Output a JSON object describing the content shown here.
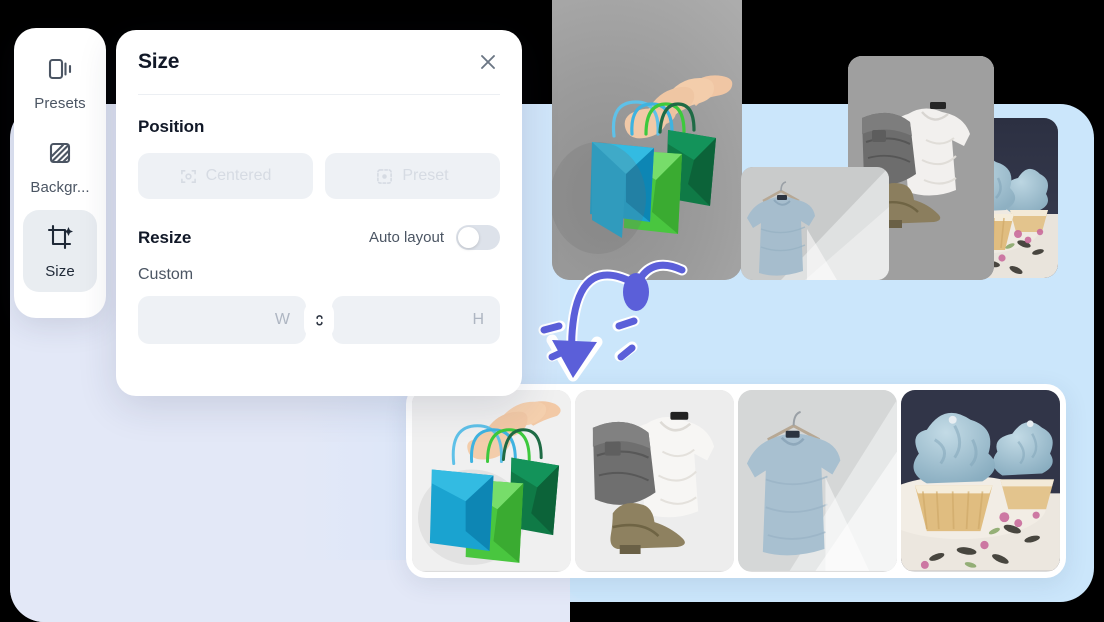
{
  "app": {
    "background_lavender": "#e3e8f7",
    "background_blue": "#cbe6fb"
  },
  "sidebar": {
    "items": [
      {
        "label": "Presets",
        "icon": "carousel-icon",
        "active": false
      },
      {
        "label": "Backgr...",
        "icon": "background-pattern-icon",
        "active": false
      },
      {
        "label": "Size",
        "icon": "crop-sparkle-icon",
        "active": true
      }
    ]
  },
  "panel": {
    "title": "Size",
    "close_icon": "close-icon",
    "position": {
      "heading": "Position",
      "buttons": [
        {
          "label": "Centered",
          "icon": "center-target-icon"
        },
        {
          "label": "Preset",
          "icon": "preset-target-icon"
        }
      ]
    },
    "resize": {
      "heading": "Resize",
      "auto_layout_label": "Auto layout",
      "auto_layout_on": false,
      "custom_label": "Custom",
      "width_value": "",
      "width_unit": "W",
      "height_value": "",
      "height_unit": "H",
      "link_icon": "unlink-aspect-ratio-icon"
    }
  },
  "canvas": {
    "cards": [
      {
        "name": "shopping-bags-card"
      },
      {
        "name": "tshirt-hanger-card"
      },
      {
        "name": "clothes-flatlay-card"
      },
      {
        "name": "cupcakes-card"
      }
    ],
    "annotation": {
      "icon": "curved-down-arrow-icon",
      "color": "#5b5fd9"
    }
  },
  "gallery": {
    "items": [
      {
        "name": "thumb-shopping-bags"
      },
      {
        "name": "thumb-clothes-flatlay"
      },
      {
        "name": "thumb-tshirt-hanger"
      },
      {
        "name": "thumb-cupcakes"
      }
    ]
  }
}
